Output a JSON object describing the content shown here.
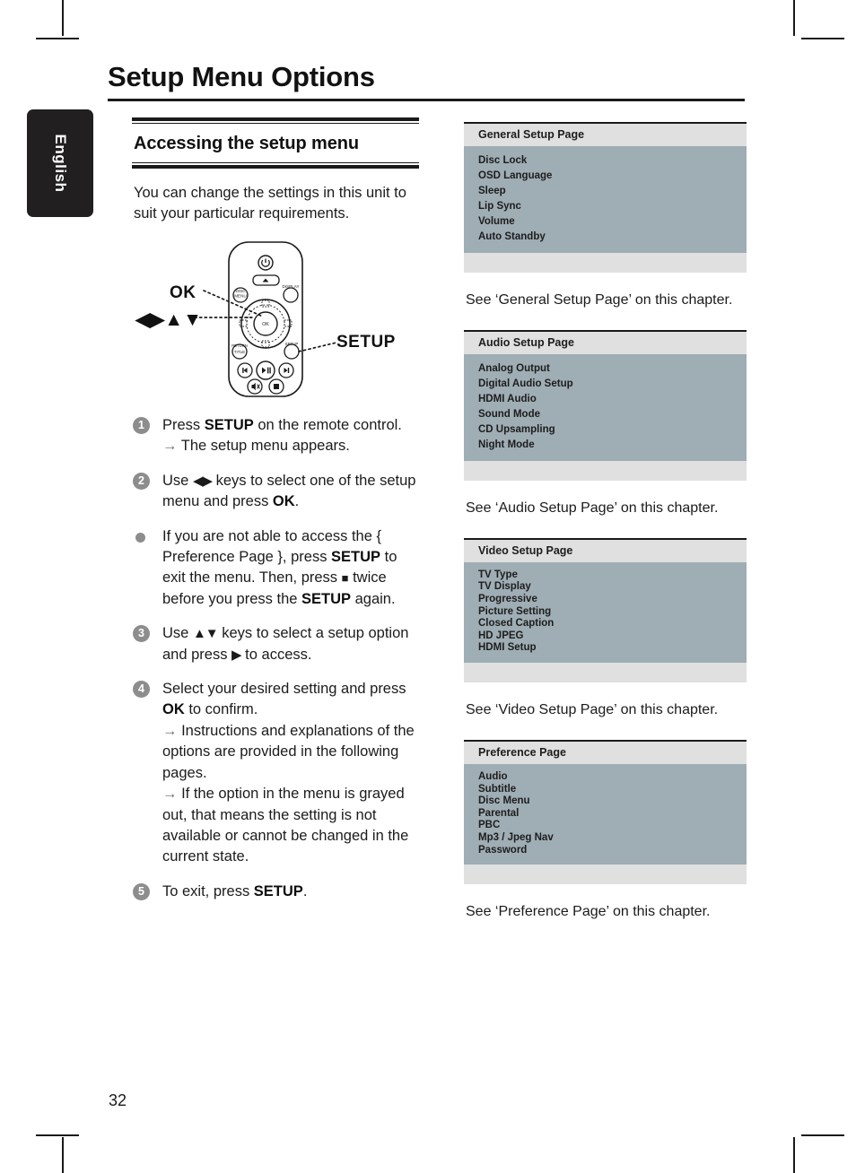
{
  "page": {
    "title": "Setup Menu Options",
    "number": "32",
    "language_tab": "English"
  },
  "left_column": {
    "section_heading": "Accessing the setup menu",
    "intro": "You can change the settings in this unit to suit your particular requirements.",
    "remote_callouts": {
      "ok": "OK",
      "navigation": "◀▶▲▼",
      "setup": "SETUP"
    },
    "steps": [
      {
        "marker": "1",
        "type": "numbered",
        "lines": [
          "Press SETUP on the remote control.",
          "→ The setup menu appears."
        ]
      },
      {
        "marker": "2",
        "type": "numbered",
        "lines": [
          "Use ◀▶ keys to select one of the setup menu and press OK."
        ]
      },
      {
        "marker": "•",
        "type": "bullet",
        "lines": [
          "If you are not able to access the { Preference Page }, press SETUP to exit the menu. Then, press ■ twice before you press the SETUP again."
        ]
      },
      {
        "marker": "3",
        "type": "numbered",
        "lines": [
          "Use ▲▼ keys to select a setup option and press ▶ to access."
        ]
      },
      {
        "marker": "4",
        "type": "numbered",
        "lines": [
          "Select your desired setting and press OK to confirm.",
          "→ Instructions and explanations of the options are provided in the following pages.",
          "→ If the option in the menu is grayed out, that means the setting is not available or cannot be changed in the current state."
        ]
      },
      {
        "marker": "5",
        "type": "numbered",
        "lines": [
          "To exit, press SETUP."
        ]
      }
    ]
  },
  "right_column": {
    "panels": [
      {
        "title": "General Setup Page",
        "items": [
          "Disc Lock",
          "OSD Language",
          "Sleep",
          "Lip Sync",
          "Volume",
          "Auto Standby"
        ],
        "caption": "See ‘General Setup Page’ on this chapter.",
        "spacing": "normal"
      },
      {
        "title": "Audio Setup Page",
        "items": [
          "Analog Output",
          "Digital Audio Setup",
          "HDMI Audio",
          "Sound Mode",
          "CD Upsampling",
          "Night Mode"
        ],
        "caption": "See ‘Audio Setup Page’ on this chapter.",
        "spacing": "normal"
      },
      {
        "title": "Video Setup Page",
        "items": [
          "TV Type",
          "TV Display",
          "Progressive",
          "Picture Setting",
          "Closed Caption",
          "HD JPEG",
          "HDMI Setup"
        ],
        "caption": "See ‘Video Setup Page’ on this chapter.",
        "spacing": "tight"
      },
      {
        "title": "Preference Page",
        "items": [
          "Audio",
          "Subtitle",
          "Disc Menu",
          "Parental",
          "PBC",
          "Mp3 / Jpeg Nav",
          "Password"
        ],
        "caption": "See ‘Preference Page’ on this chapter.",
        "spacing": "tight"
      }
    ]
  },
  "remote": {
    "buttons": {
      "power": "power-standby",
      "eject": "eject",
      "disc_menu": "DISC MENU",
      "display": "DISPLAY",
      "ok": "OK",
      "return_title": "RETURN/TITLE",
      "setup": "SETUP",
      "previous": "previous",
      "play_pause": "play-pause",
      "next": "next",
      "mute": "mute",
      "stop": "stop"
    }
  },
  "colors": {
    "panel_header_bg": "#e0e0e0",
    "panel_body_bg": "#9fadb4",
    "tab_bg": "#211f20",
    "step_marker_bg": "#8d8d8d",
    "rule": "#1a1a1a"
  }
}
